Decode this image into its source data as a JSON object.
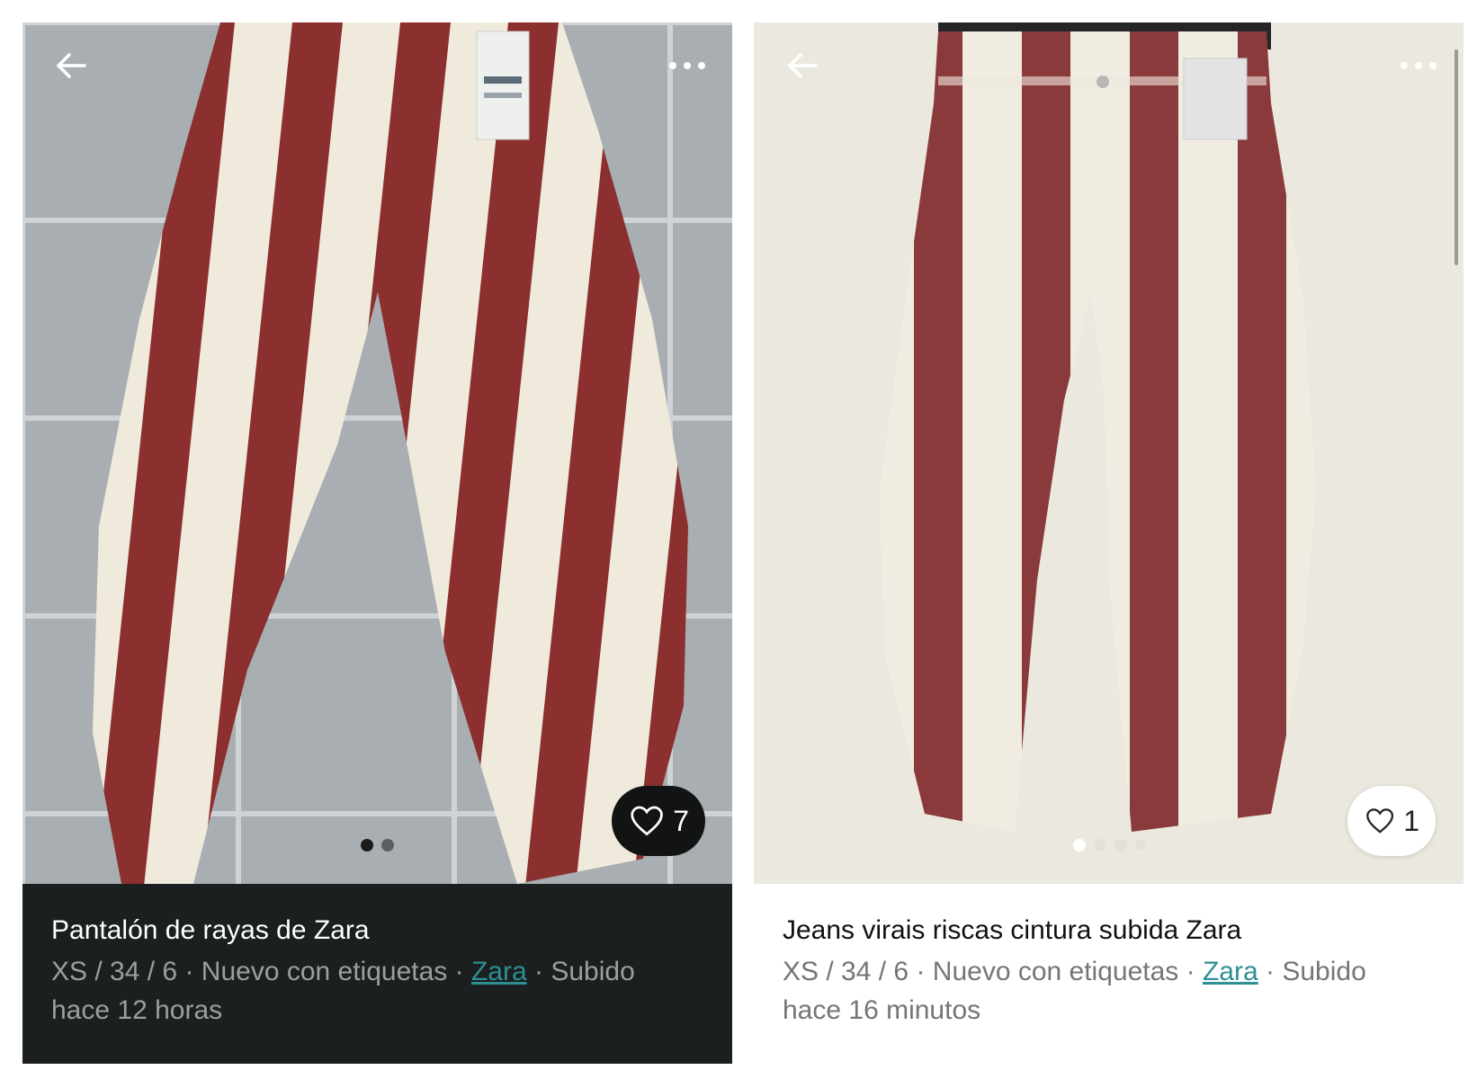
{
  "listings": [
    {
      "title": "Pantalón de rayas de Zara",
      "size": "XS / 34 / 6",
      "condition": "Nuevo con etiquetas",
      "brand": "Zara",
      "uploaded_label": "Subido",
      "uploaded_time": "hace 12 horas",
      "separator": "·",
      "favorites": "7",
      "photo_count": 2,
      "active_photo": 1,
      "icons": {
        "back": "arrow-left-icon",
        "more": "more-dots-icon",
        "favorite": "heart-icon"
      }
    },
    {
      "title": "Jeans virais riscas cintura subida Zara",
      "size": "XS / 34 / 6",
      "condition": "Nuevo con etiquetas",
      "brand": "Zara",
      "uploaded_label": "Subido",
      "uploaded_time": "hace 16 minutos",
      "separator": "·",
      "favorites": "1",
      "photo_count": 4,
      "active_photo": 1,
      "icons": {
        "back": "arrow-left-icon",
        "more": "more-dots-icon",
        "favorite": "heart-icon"
      }
    }
  ],
  "colors": {
    "stripe_red": "#8e3232",
    "stripe_cream": "#f1ece0",
    "floor_grey": "#a8adb2",
    "wall_cream": "#ecebe1",
    "dark_panel": "#1b1f1f",
    "link_teal": "#2e8f93"
  }
}
